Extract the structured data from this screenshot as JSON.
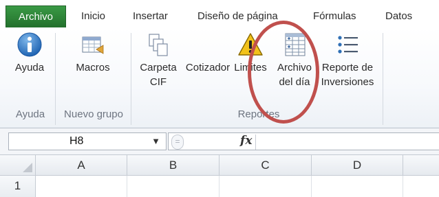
{
  "tabs": [
    {
      "label": "Archivo"
    },
    {
      "label": "Inicio"
    },
    {
      "label": "Insertar"
    },
    {
      "label": "Diseño de página"
    },
    {
      "label": "Fórmulas"
    },
    {
      "label": "Datos"
    }
  ],
  "ribbon": {
    "buttons": [
      {
        "line1": "Ayuda",
        "icon": "info-icon"
      },
      {
        "line1": "Macros",
        "icon": "macros-icon"
      },
      {
        "line1": "Carpeta",
        "line2": "CIF",
        "icon": "folder-copy-icon"
      },
      {
        "line1": "Cotizador",
        "icon": "cotizador-icon"
      },
      {
        "line1": "Limites",
        "icon": "warning-icon"
      },
      {
        "line1": "Archivo",
        "line2": "del día",
        "icon": "table-icon"
      },
      {
        "line1": "Reporte de",
        "line2": "Inversiones",
        "icon": "list-icon"
      }
    ],
    "groups": [
      {
        "label": "Ayuda"
      },
      {
        "label": "Nuevo grupo"
      },
      {
        "label": "Reportes"
      }
    ]
  },
  "formula_bar": {
    "name_box": "H8",
    "dropdown_glyph": "▼",
    "fx_label": "fx"
  },
  "sheet": {
    "columns": [
      "A",
      "B",
      "C",
      "D"
    ],
    "rows": [
      "1"
    ]
  },
  "colors": {
    "file_tab": "#2a7d34",
    "highlight_ring": "#c0504d",
    "info_blue": "#2f78c4",
    "warning_yellow": "#f2c21b"
  }
}
